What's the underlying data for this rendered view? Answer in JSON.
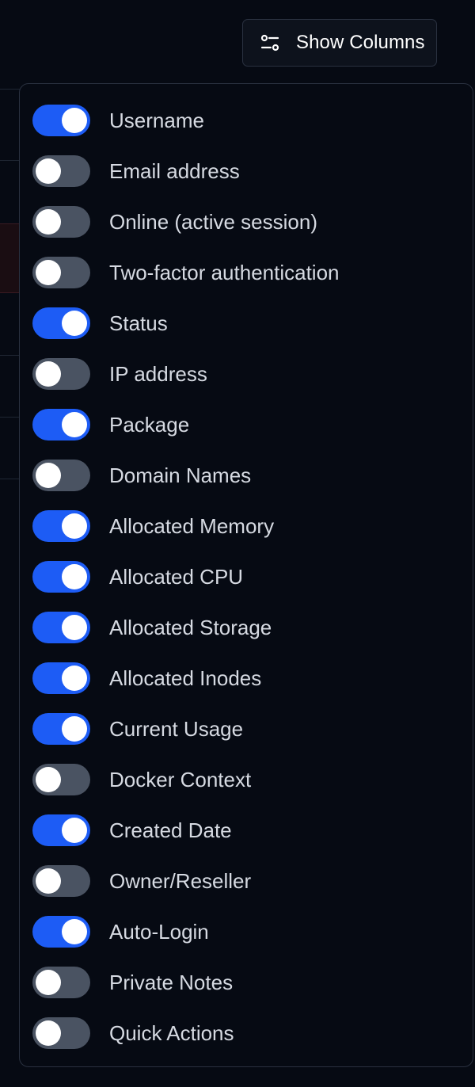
{
  "header": {
    "show_columns_label": "Show Columns",
    "icon": "sliders-icon"
  },
  "columns": [
    {
      "label": "Username",
      "enabled": true
    },
    {
      "label": "Email address",
      "enabled": false
    },
    {
      "label": "Online (active session)",
      "enabled": false
    },
    {
      "label": "Two-factor authentication",
      "enabled": false
    },
    {
      "label": "Status",
      "enabled": true
    },
    {
      "label": "IP address",
      "enabled": false
    },
    {
      "label": "Package",
      "enabled": true
    },
    {
      "label": "Domain Names",
      "enabled": false
    },
    {
      "label": "Allocated Memory",
      "enabled": true
    },
    {
      "label": "Allocated CPU",
      "enabled": true
    },
    {
      "label": "Allocated Storage",
      "enabled": true
    },
    {
      "label": "Allocated Inodes",
      "enabled": true
    },
    {
      "label": "Current Usage",
      "enabled": true
    },
    {
      "label": "Docker Context",
      "enabled": false
    },
    {
      "label": "Created Date",
      "enabled": true
    },
    {
      "label": "Owner/Reseller",
      "enabled": false
    },
    {
      "label": "Auto-Login",
      "enabled": true
    },
    {
      "label": "Private Notes",
      "enabled": false
    },
    {
      "label": "Quick Actions",
      "enabled": false
    }
  ],
  "colors": {
    "toggle_on": "#1d5cf5",
    "toggle_off": "#4a5362",
    "background": "#060a13"
  }
}
